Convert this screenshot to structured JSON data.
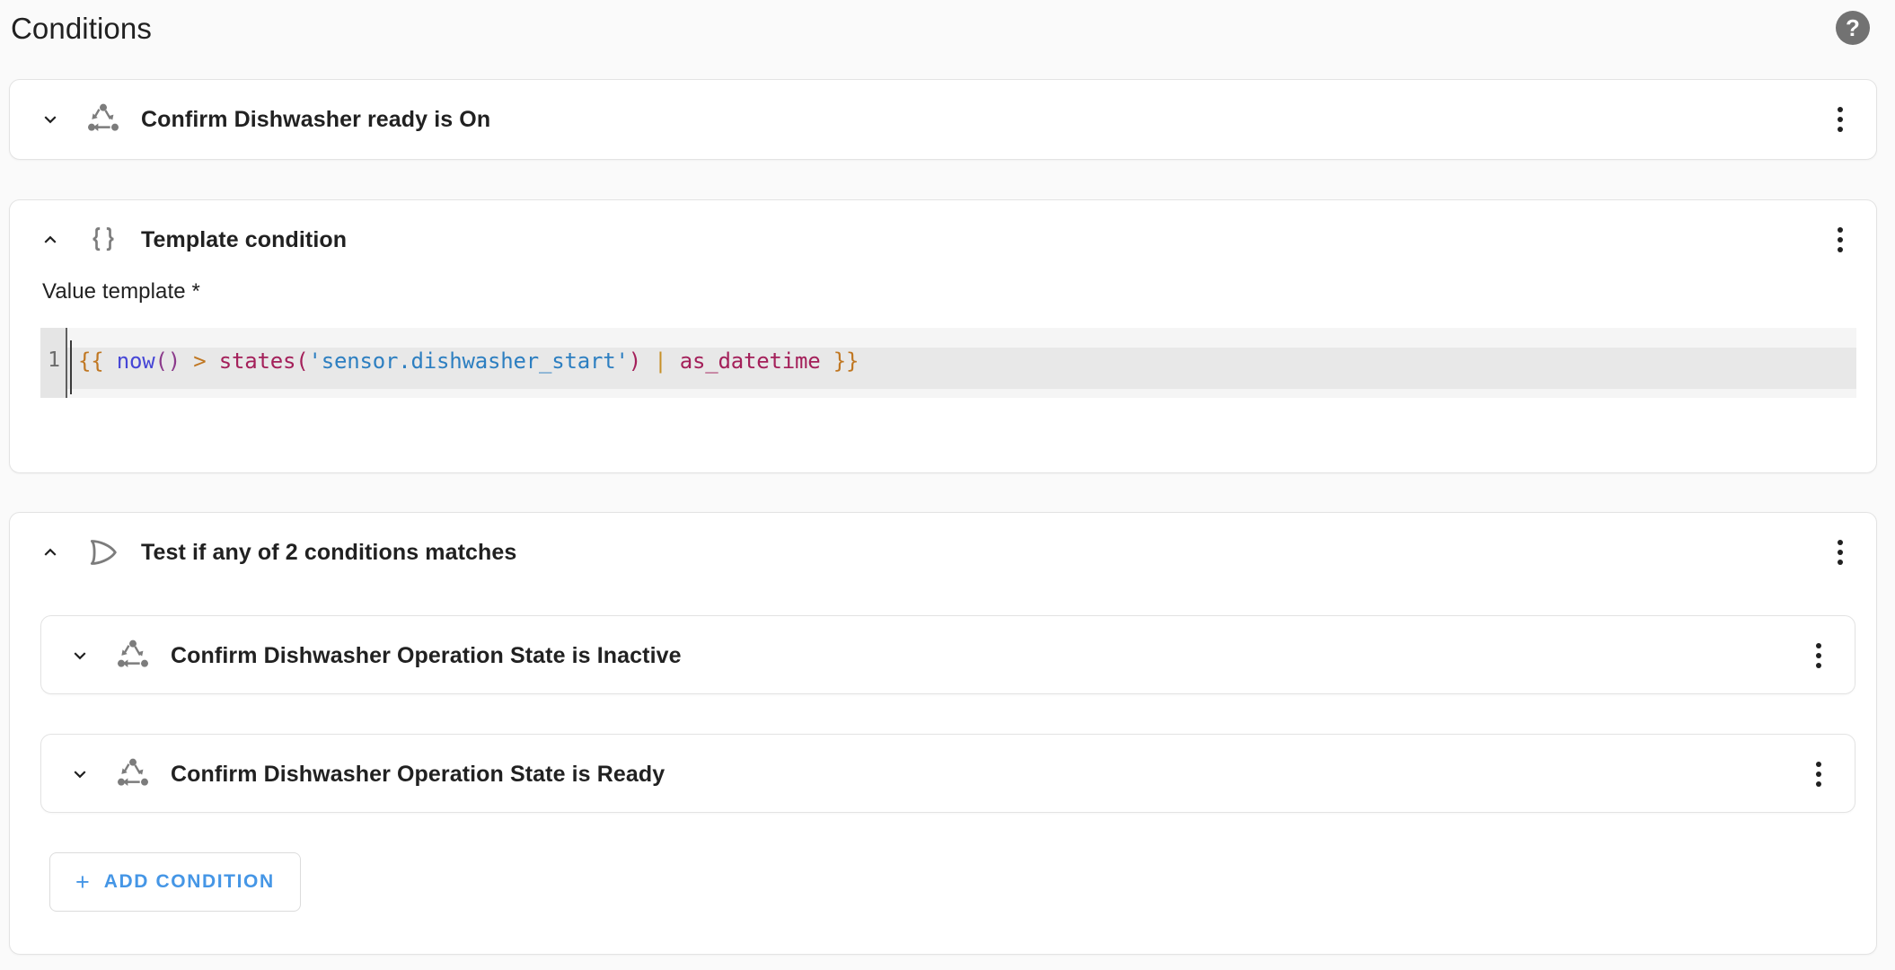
{
  "header": {
    "title": "Conditions",
    "help_icon": "help-circle-icon",
    "help_glyph": "?"
  },
  "conditions": [
    {
      "id": "confirm-dishwasher-ready",
      "title": "Confirm Dishwasher ready is On",
      "icon": "state-machine-icon",
      "expanded": false,
      "chevron": "chevron-down-icon",
      "menu": "overflow-menu-icon"
    },
    {
      "id": "template-condition",
      "title": "Template condition",
      "icon": "code-braces-icon",
      "expanded": true,
      "chevron": "chevron-up-icon",
      "menu": "overflow-menu-icon",
      "field_label": "Value template *",
      "editor": {
        "line_number": "1",
        "tokens": [
          {
            "text": "{{",
            "type": "brace"
          },
          {
            "text": " ",
            "type": "plain"
          },
          {
            "text": "now",
            "type": "fn"
          },
          {
            "text": "()",
            "type": "paren"
          },
          {
            "text": " ",
            "type": "plain"
          },
          {
            "text": ">",
            "type": "op"
          },
          {
            "text": " ",
            "type": "plain"
          },
          {
            "text": "states",
            "type": "func"
          },
          {
            "text": "(",
            "type": "mparen"
          },
          {
            "text": "'sensor.dishwasher_start'",
            "type": "str"
          },
          {
            "text": ")",
            "type": "mparen"
          },
          {
            "text": " ",
            "type": "plain"
          },
          {
            "text": "|",
            "type": "pipe"
          },
          {
            "text": " ",
            "type": "plain"
          },
          {
            "text": "as_datetime",
            "type": "filter"
          },
          {
            "text": " ",
            "type": "plain"
          },
          {
            "text": "}}",
            "type": "brace"
          }
        ],
        "plain_text": "{{ now() > states('sensor.dishwasher_start') | as_datetime }}"
      }
    },
    {
      "id": "or-condition-group",
      "title": "Test if any of 2 conditions matches",
      "icon": "gate-or-icon",
      "expanded": true,
      "chevron": "chevron-up-icon",
      "menu": "overflow-menu-icon",
      "children": [
        {
          "id": "confirm-operation-state-inactive",
          "title": "Confirm Dishwasher Operation State is Inactive",
          "icon": "state-machine-icon",
          "expanded": false,
          "chevron": "chevron-down-icon",
          "menu": "overflow-menu-icon"
        },
        {
          "id": "confirm-operation-state-ready",
          "title": "Confirm Dishwasher Operation State is Ready",
          "icon": "state-machine-icon",
          "expanded": false,
          "chevron": "chevron-down-icon",
          "menu": "overflow-menu-icon"
        }
      ],
      "add_button": {
        "label": "ADD CONDITION",
        "icon": "plus-icon",
        "glyph": "+"
      }
    }
  ],
  "colors": {
    "page_background": "#fafafa",
    "card_background": "#ffffff",
    "card_border": "#e3e3e3",
    "text_primary": "#212121",
    "icon_gray": "#7c7c7c",
    "accent_blue": "#4596e6",
    "editor_background": "#f5f5f5",
    "editor_active_line": "#e8e8e8",
    "editor_gutter": "#e5e5e5"
  }
}
